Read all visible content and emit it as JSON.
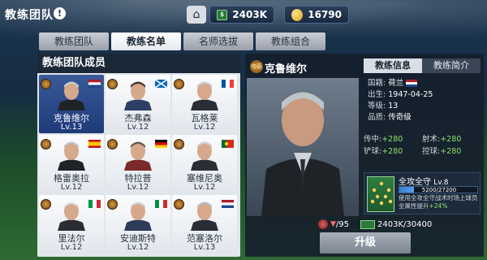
{
  "header": {
    "title": "教练团队",
    "info": "!",
    "cash": "2403K",
    "coins": "16790"
  },
  "tabs": [
    "教练团队",
    "教练名单",
    "名师选拔",
    "教练组合"
  ],
  "active_tab": 1,
  "left_panel": {
    "title": "教练团队成员"
  },
  "coaches": [
    {
      "name": "克鲁维尔",
      "level": "Lv.13",
      "flag": "NL",
      "selected": true
    },
    {
      "name": "杰弗森",
      "level": "Lv.12",
      "flag": "SCO"
    },
    {
      "name": "瓦格莱",
      "level": "Lv.12",
      "flag": "FR"
    },
    {
      "name": "格雷奥拉",
      "level": "Lv.12",
      "flag": "ES"
    },
    {
      "name": "特拉普",
      "level": "Lv.12",
      "flag": "DE"
    },
    {
      "name": "塞维尼奥",
      "level": "Lv.12",
      "flag": "PT"
    },
    {
      "name": "里法尔",
      "level": "Lv.12",
      "flag": "IT"
    },
    {
      "name": "安迪斯特",
      "level": "Lv.12",
      "flag": "IT"
    },
    {
      "name": "范塞洛尔",
      "level": "Lv.13",
      "flag": "NL"
    }
  ],
  "detail": {
    "legend_badge": "传奇",
    "name": "克鲁维尔",
    "tabs": [
      "教练信息",
      "教练简介"
    ],
    "country_label": "国籍:",
    "country": "荷兰",
    "born_label": "出生:",
    "born": "1947-04-25",
    "level_label": "等级:",
    "level": "13",
    "quality_label": "品质:",
    "quality": "传奇级",
    "attrs": [
      {
        "label": "传中:",
        "value": "+280"
      },
      {
        "label": "射术:",
        "value": "+280"
      },
      {
        "label": "铲球:",
        "value": "+280"
      },
      {
        "label": "控球:",
        "value": "+280"
      }
    ],
    "skill": {
      "name": "全攻全守",
      "level": "Lv.8",
      "progress": "5200/27200",
      "progress_fraction": 0.191,
      "desc": "使用全攻全守战术时场上球员全属性提升",
      "bonus": "+24%"
    },
    "stats": {
      "count": "/95",
      "cash": "2403K",
      "cash_req": "/30400"
    },
    "upgrade": "升级"
  },
  "colors": {
    "green": "#8fe06b",
    "panel_dark": "#16202c",
    "selected": "#1e3a78"
  }
}
